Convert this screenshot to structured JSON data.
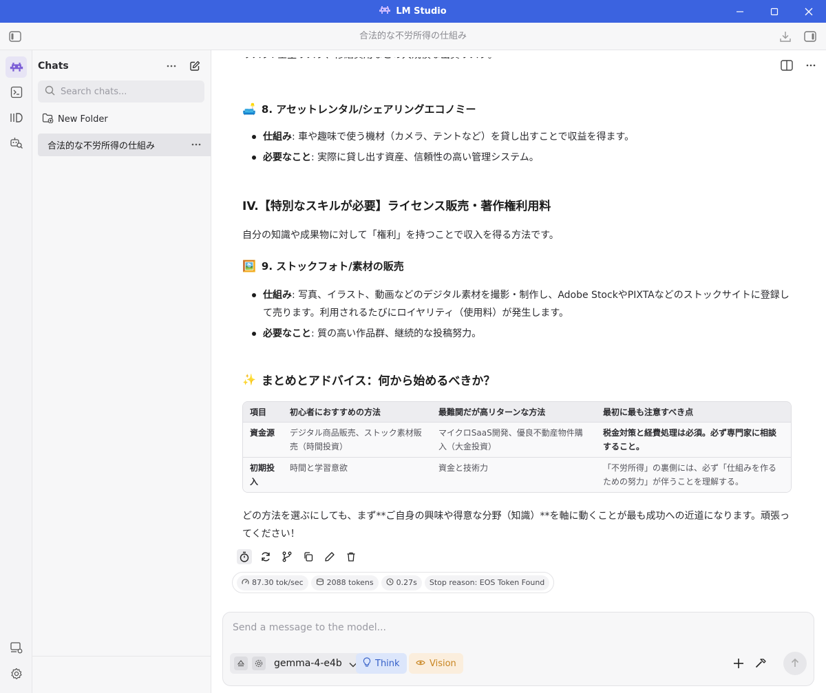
{
  "window": {
    "title": "LM Studio"
  },
  "topbar": {
    "chat_title": "合法的な不労所得の仕組み"
  },
  "sidebar": {
    "header": "Chats",
    "search_placeholder": "Search chats...",
    "new_folder": "New Folder",
    "chats": [
      {
        "title": "合法的な不労所得の仕組み",
        "selected": true
      }
    ]
  },
  "message": {
    "cut_line": "リスク: 空室リスク、修繕費用などの大規模な出費リスク。",
    "s8": {
      "emoji": "🛋️",
      "heading": "8. アセットレンタル/シェアリングエコノミー",
      "items": [
        {
          "label": "仕組み",
          "text": ": 車や趣味で使う機材（カメラ、テントなど）を貸し出すことで収益を得ます。"
        },
        {
          "label": "必要なこと",
          "text": ": 実際に貸し出す資産、信頼性の高い管理システム。"
        }
      ]
    },
    "sec4": {
      "heading": "IV.【特別なスキルが必要】ライセンス販売・著作権利用料",
      "intro": "自分の知識や成果物に対して「権利」を持つことで収入を得る方法です。"
    },
    "s9": {
      "emoji": "🖼️",
      "heading": "9. ストックフォト/素材の販売",
      "items": [
        {
          "label": "仕組み",
          "text": ": 写真、イラスト、動画などのデジタル素材を撮影・制作し、Adobe StockやPIXTAなどのストックサイトに登録して売ります。利用されるたびにロイヤリティ（使用料）が発生します。"
        },
        {
          "label": "必要なこと",
          "text": ": 質の高い作品群、継続的な投稿努力。"
        }
      ]
    },
    "summary": {
      "emoji": "✨",
      "heading": "まとめとアドバイス：何から始めるべきか？"
    },
    "table": {
      "headers": [
        "項目",
        "初心者におすすめの方法",
        "最難関だが高リターンな方法",
        "最初に最も注意すべき点"
      ],
      "rows": [
        [
          "資金源",
          "デジタル商品販売、ストック素材販売（時間投資）",
          "マイクロSaaS開発、優良不動産物件購入（大金投資）",
          "税金対策と経費処理は必須。必ず専門家に相談すること。"
        ],
        [
          "初期投入",
          "時間と学習意欲",
          "資金と技術力",
          "「不労所得」の裏側には、必ず「仕組みを作るための努力」が伴うことを理解する。"
        ]
      ]
    },
    "closing": "どの方法を選ぶにしても、まず**ご自身の興味や得意な分野（知識）**を軸に動くことが最も成功への近道になります。頑張ってください！"
  },
  "stats": {
    "speed": "87.30 tok/sec",
    "tokens": "2088 tokens",
    "time": "0.27s",
    "stop_reason": "Stop reason: EOS Token Found"
  },
  "composer": {
    "placeholder": "Send a message to the model...",
    "model": "gemma-4-e4b",
    "think": "Think",
    "vision": "Vision"
  },
  "colors": {
    "titlebar": "#3b63e0",
    "accent": "#7a5cd6",
    "think": "#3560c8",
    "vision": "#c88521"
  }
}
